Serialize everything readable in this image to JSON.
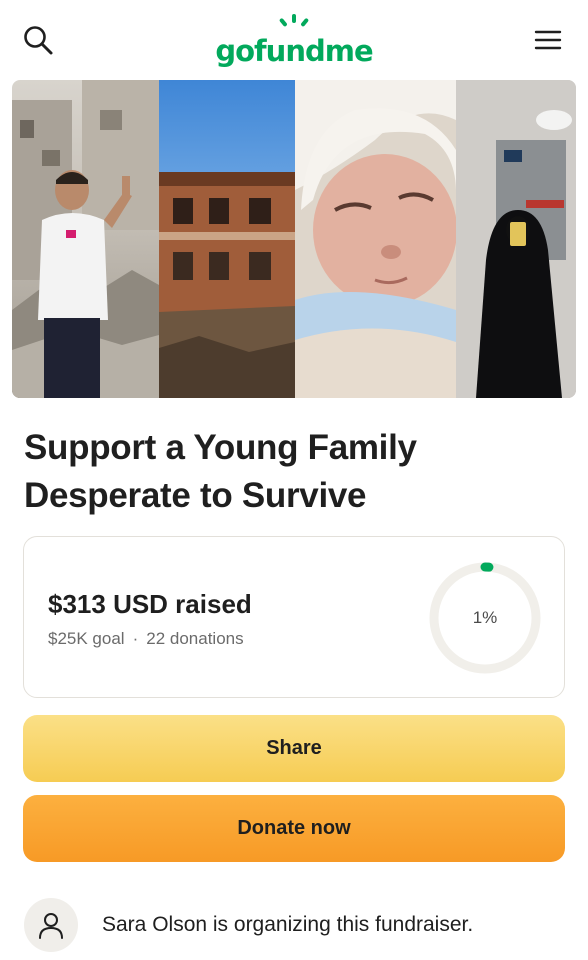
{
  "header": {
    "logo_text": "gofundme",
    "search_icon": "search-icon",
    "menu_icon": "hamburger-menu-icon"
  },
  "campaign": {
    "title": "Support a Young Family Desperate to Survive"
  },
  "stats": {
    "raised_text": "$313 USD raised",
    "goal_text": "$25K goal",
    "separator": "·",
    "donations_text": "22 donations",
    "percent_label": "1%",
    "progress_fraction": 0.0125
  },
  "actions": {
    "share_label": "Share",
    "donate_label": "Donate now"
  },
  "organizer": {
    "text": "Sara Olson is organizing this fundraiser.",
    "avatar_icon": "user-icon"
  },
  "colors": {
    "brand_green": "#02a95c",
    "share_yellow": "#f6cc53",
    "donate_orange": "#f79a26",
    "ring_track": "#f1efea"
  }
}
